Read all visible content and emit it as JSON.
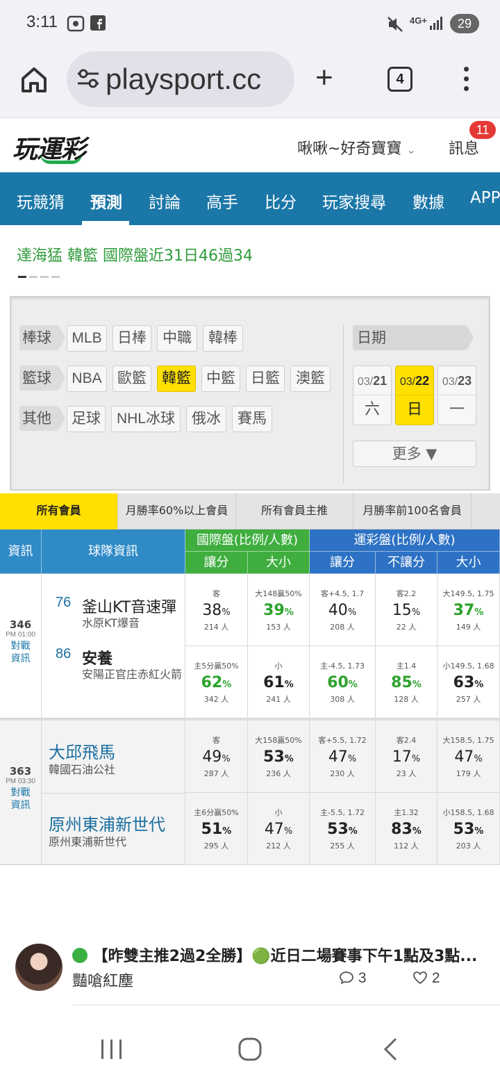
{
  "status": {
    "time": "3:11",
    "network": "4G+",
    "battery": "29"
  },
  "browser": {
    "url": "playsport.cc",
    "tab_count": "4"
  },
  "site": {
    "logo": "玩運彩",
    "user": "啾啾~好奇寶寶",
    "messages_label": "訊息",
    "messages_count": "11"
  },
  "nav": [
    "玩競猜",
    "預測",
    "討論",
    "高手",
    "比分",
    "玩家搜尋",
    "數據",
    "APP"
  ],
  "ticker": "達海猛 韓籃 國際盤近31日46過34",
  "filters": {
    "baseball": {
      "label": "棒球",
      "items": [
        "MLB",
        "日棒",
        "中職",
        "韓棒"
      ]
    },
    "basketball": {
      "label": "籃球",
      "items": [
        "NBA",
        "歐籃",
        "韓籃",
        "中籃",
        "日籃",
        "澳籃"
      ]
    },
    "other": {
      "label": "其他",
      "items": [
        "足球",
        "NHL冰球",
        "俄冰",
        "賽馬"
      ]
    },
    "date_label": "日期",
    "dates": [
      {
        "month": "03/",
        "day": "21",
        "weekday": "六"
      },
      {
        "month": "03/",
        "day": "22",
        "weekday": "日"
      },
      {
        "month": "03/",
        "day": "23",
        "weekday": "一"
      }
    ],
    "more": "更多 ▼"
  },
  "member_tabs": [
    "所有會員",
    "月勝率60%以上會員",
    "所有會員主推",
    "月勝率前100名會員"
  ],
  "table_headers": {
    "info": "資訊",
    "team": "球隊資訊",
    "intl": "國際盤(比例/人數)",
    "sport": "運彩盤(比例/人數)",
    "spread": "讓分",
    "ou": "大小",
    "spread2": "讓分",
    "ml": "不讓分",
    "ou2": "大小"
  },
  "games": [
    {
      "id": "346",
      "time": "PM 01:00",
      "link": "對戰資訊",
      "teams": [
        {
          "rank": "76",
          "name": "釜山KT音速彈",
          "sub": "水原KT爆音",
          "cells": [
            {
              "top": "客",
              "pct": "38",
              "ppl": "214 人"
            },
            {
              "top": "大148贏50%",
              "pct": "39",
              "ppl": "153 人"
            },
            {
              "top": "客+4.5, 1.7",
              "pct": "40",
              "ppl": "208 人"
            },
            {
              "top": "客2.2",
              "pct": "15",
              "ppl": "22 人"
            },
            {
              "top": "大149.5, 1.75",
              "pct": "37",
              "ppl": "149 人"
            }
          ]
        },
        {
          "rank": "86",
          "name": "安養",
          "sub": "安陽正官庄赤紅火箭",
          "cells": [
            {
              "top": "主5分贏50%",
              "pct": "62",
              "ppl": "342 人"
            },
            {
              "top": "小",
              "pct": "61",
              "ppl": "241 人"
            },
            {
              "top": "主-4.5, 1.73",
              "pct": "60",
              "ppl": "308 人"
            },
            {
              "top": "主1.4",
              "pct": "85",
              "ppl": "128 人"
            },
            {
              "top": "小149.5, 1.68",
              "pct": "63",
              "ppl": "257 人"
            }
          ]
        }
      ]
    },
    {
      "id": "363",
      "time": "PM 03:30",
      "link": "對戰資訊",
      "teams": [
        {
          "name": "大邱飛馬",
          "sub": "韓國石油公社",
          "cells": [
            {
              "top": "客",
              "pct": "49",
              "ppl": "287 人"
            },
            {
              "top": "大158贏50%",
              "pct": "53",
              "ppl": "236 人"
            },
            {
              "top": "客+5.5, 1.72",
              "pct": "47",
              "ppl": "230 人"
            },
            {
              "top": "客2.4",
              "pct": "17",
              "ppl": "23 人"
            },
            {
              "top": "大158.5, 1.75",
              "pct": "47",
              "ppl": "179 人"
            }
          ]
        },
        {
          "name": "原州東浦新世代",
          "sub": "原州東浦新世代",
          "cells": [
            {
              "top": "主6分贏50%",
              "pct": "51",
              "ppl": "295 人"
            },
            {
              "top": "小",
              "pct": "47",
              "ppl": "212 人"
            },
            {
              "top": "主-5.5, 1.72",
              "pct": "53",
              "ppl": "255 人"
            },
            {
              "top": "主1.32",
              "pct": "83",
              "ppl": "112 人"
            },
            {
              "top": "小158.5, 1.68",
              "pct": "53",
              "ppl": "203 人"
            }
          ]
        }
      ]
    }
  ],
  "pct_unit": "%",
  "post": {
    "title": "【昨雙主推2過2全勝】🟢近日二場賽事下午1點及3點...",
    "author": "豔嗆紅塵",
    "comments": "3",
    "likes": "2"
  },
  "colors": {
    "brand_blue": "#1b77a8",
    "highlight_yellow": "#ffe000",
    "win_green": "#2da32d"
  }
}
